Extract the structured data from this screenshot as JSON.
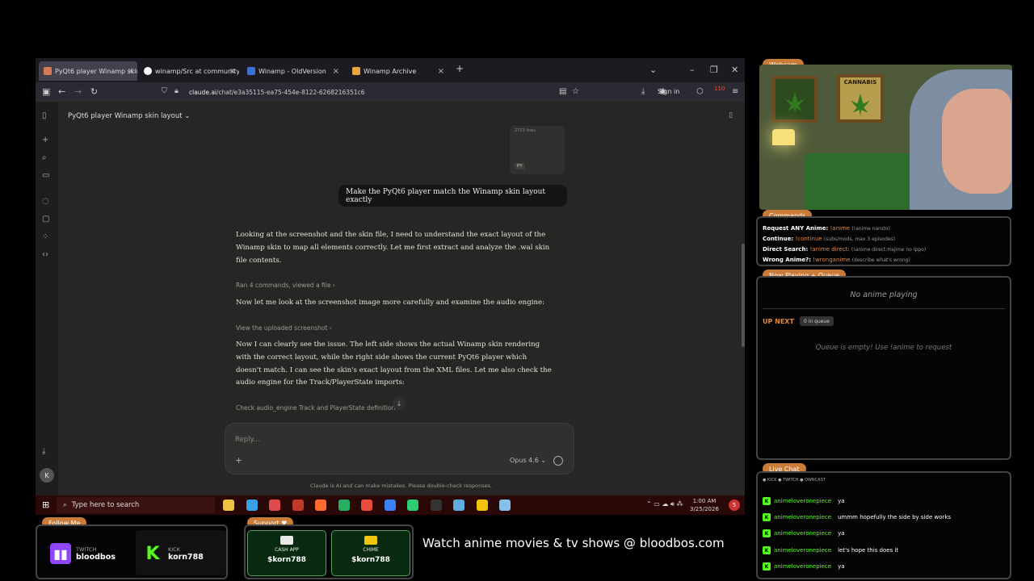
{
  "browser": {
    "tabs": [
      {
        "label": "PyQt6 player Winamp skin layo",
        "icon_color": "#d97757"
      },
      {
        "label": "winamp/Src at community · ale",
        "icon_color": "#ffffff"
      },
      {
        "label": "Winamp - OldVersion",
        "icon_color": "#3b6fd6"
      },
      {
        "label": "Winamp Archive",
        "icon_color": "#e6a23c"
      }
    ],
    "new_tab": "+",
    "url_host": "claude.ai",
    "url_path": "/chat/e3a35115-ea75-454e-8122-6268216351c6",
    "signin_label": "Sign in",
    "ext_badge": "110"
  },
  "claude": {
    "chat_title": "PyQt6 player Winamp skin layout",
    "file_size": "2713 lines",
    "file_type": "PY",
    "user_message": "Make the PyQt6 player match the Winamp skin layout exactly",
    "para1": "Looking at the screenshot and the skin file, I need to understand the exact layout of the Winamp skin to map all elements correctly. Let me first extract and analyze the .wal skin file contents.",
    "meta1": "Ran 4 commands, viewed a file",
    "para2": "Now let me look at the screenshot image more carefully and examine the audio engine:",
    "meta2": "View the uploaded screenshot",
    "para3": "Now I can clearly see the issue. The left side shows the actual Winamp skin rendering with the correct layout, while the right side shows the current PyQt6 player which doesn't match. I can see the skin's exact layout from the XML files. Let me also check the audio engine for the Track/PlayerState imports:",
    "meta3": "Check audio_engine Track and PlayerState definition",
    "reply_placeholder": "Reply...",
    "model": "Opus 4.6",
    "disclaimer": "Claude is AI and can make mistakes. Please double-check responses.",
    "avatar_initial": "K"
  },
  "taskbar": {
    "search_placeholder": "Type here to search",
    "time": "1:00 AM",
    "date": "3/25/2026",
    "notif_count": "5",
    "icons": [
      "#f0c040",
      "#3aa0e8",
      "#e04c4c",
      "#c0392b",
      "#ff6b2c",
      "#27ae60",
      "#e74c3c",
      "#3b82f6",
      "#2ecc71",
      "#333333",
      "#5dade2",
      "#f1c40f",
      "#85c1e9"
    ]
  },
  "overlay": {
    "webcam_label": "Webcam",
    "cannabis_label": "CANNABIS",
    "commands_label": "Commands",
    "commands": [
      {
        "label": "Request ANY Anime:",
        "cmd": "!anime",
        "desc": "(!anime naruto)"
      },
      {
        "label": "Continue:",
        "cmd": "!continue",
        "desc": "(subs/mods, max 3 episodes)"
      },
      {
        "label": "Direct Search:",
        "cmd": "!anime direct:",
        "desc": "(!anime direct:Hajime no Ippo)"
      },
      {
        "label": "Wrong Anime?:",
        "cmd": "!wronganime",
        "desc": "(describe what's wrong)"
      }
    ],
    "now_playing_label": "Now Playing + Queue",
    "no_anime": "No anime playing",
    "up_next": "UP NEXT",
    "in_queue": "0 in queue",
    "queue_empty": "Queue is empty! Use !anime to request",
    "live_chat_label": "Live Chat",
    "platforms": "● KICK  ● TWITCH  ● OWNCAST",
    "chat": [
      {
        "user": "animeloveronepiece",
        "text": "ya"
      },
      {
        "user": "animeloveronepiece",
        "text": "ummm hopefully the side by side works"
      },
      {
        "user": "animeloveronepiece",
        "text": "ya"
      },
      {
        "user": "animeloveronepiece",
        "text": "let's hope this does it"
      },
      {
        "user": "animeloveronepiece",
        "text": "ya"
      }
    ],
    "follow_label": "Follow Me",
    "twitch_platform": "TWITCH",
    "twitch_name": "bloodbos",
    "kick_platform": "KICK",
    "kick_name": "korn788",
    "support_label": "Support ♥",
    "cashapp_label": "CASH APP",
    "cashapp_handle": "$korn788",
    "chime_label": "CHIME",
    "chime_handle": "$korn788",
    "watch_line": "Watch anime movies & tv shows @ bloodbos.com"
  },
  "colors": {
    "accent": "#c97b3a",
    "kick_green": "#53fc18",
    "twitch_purple": "#9146ff"
  }
}
